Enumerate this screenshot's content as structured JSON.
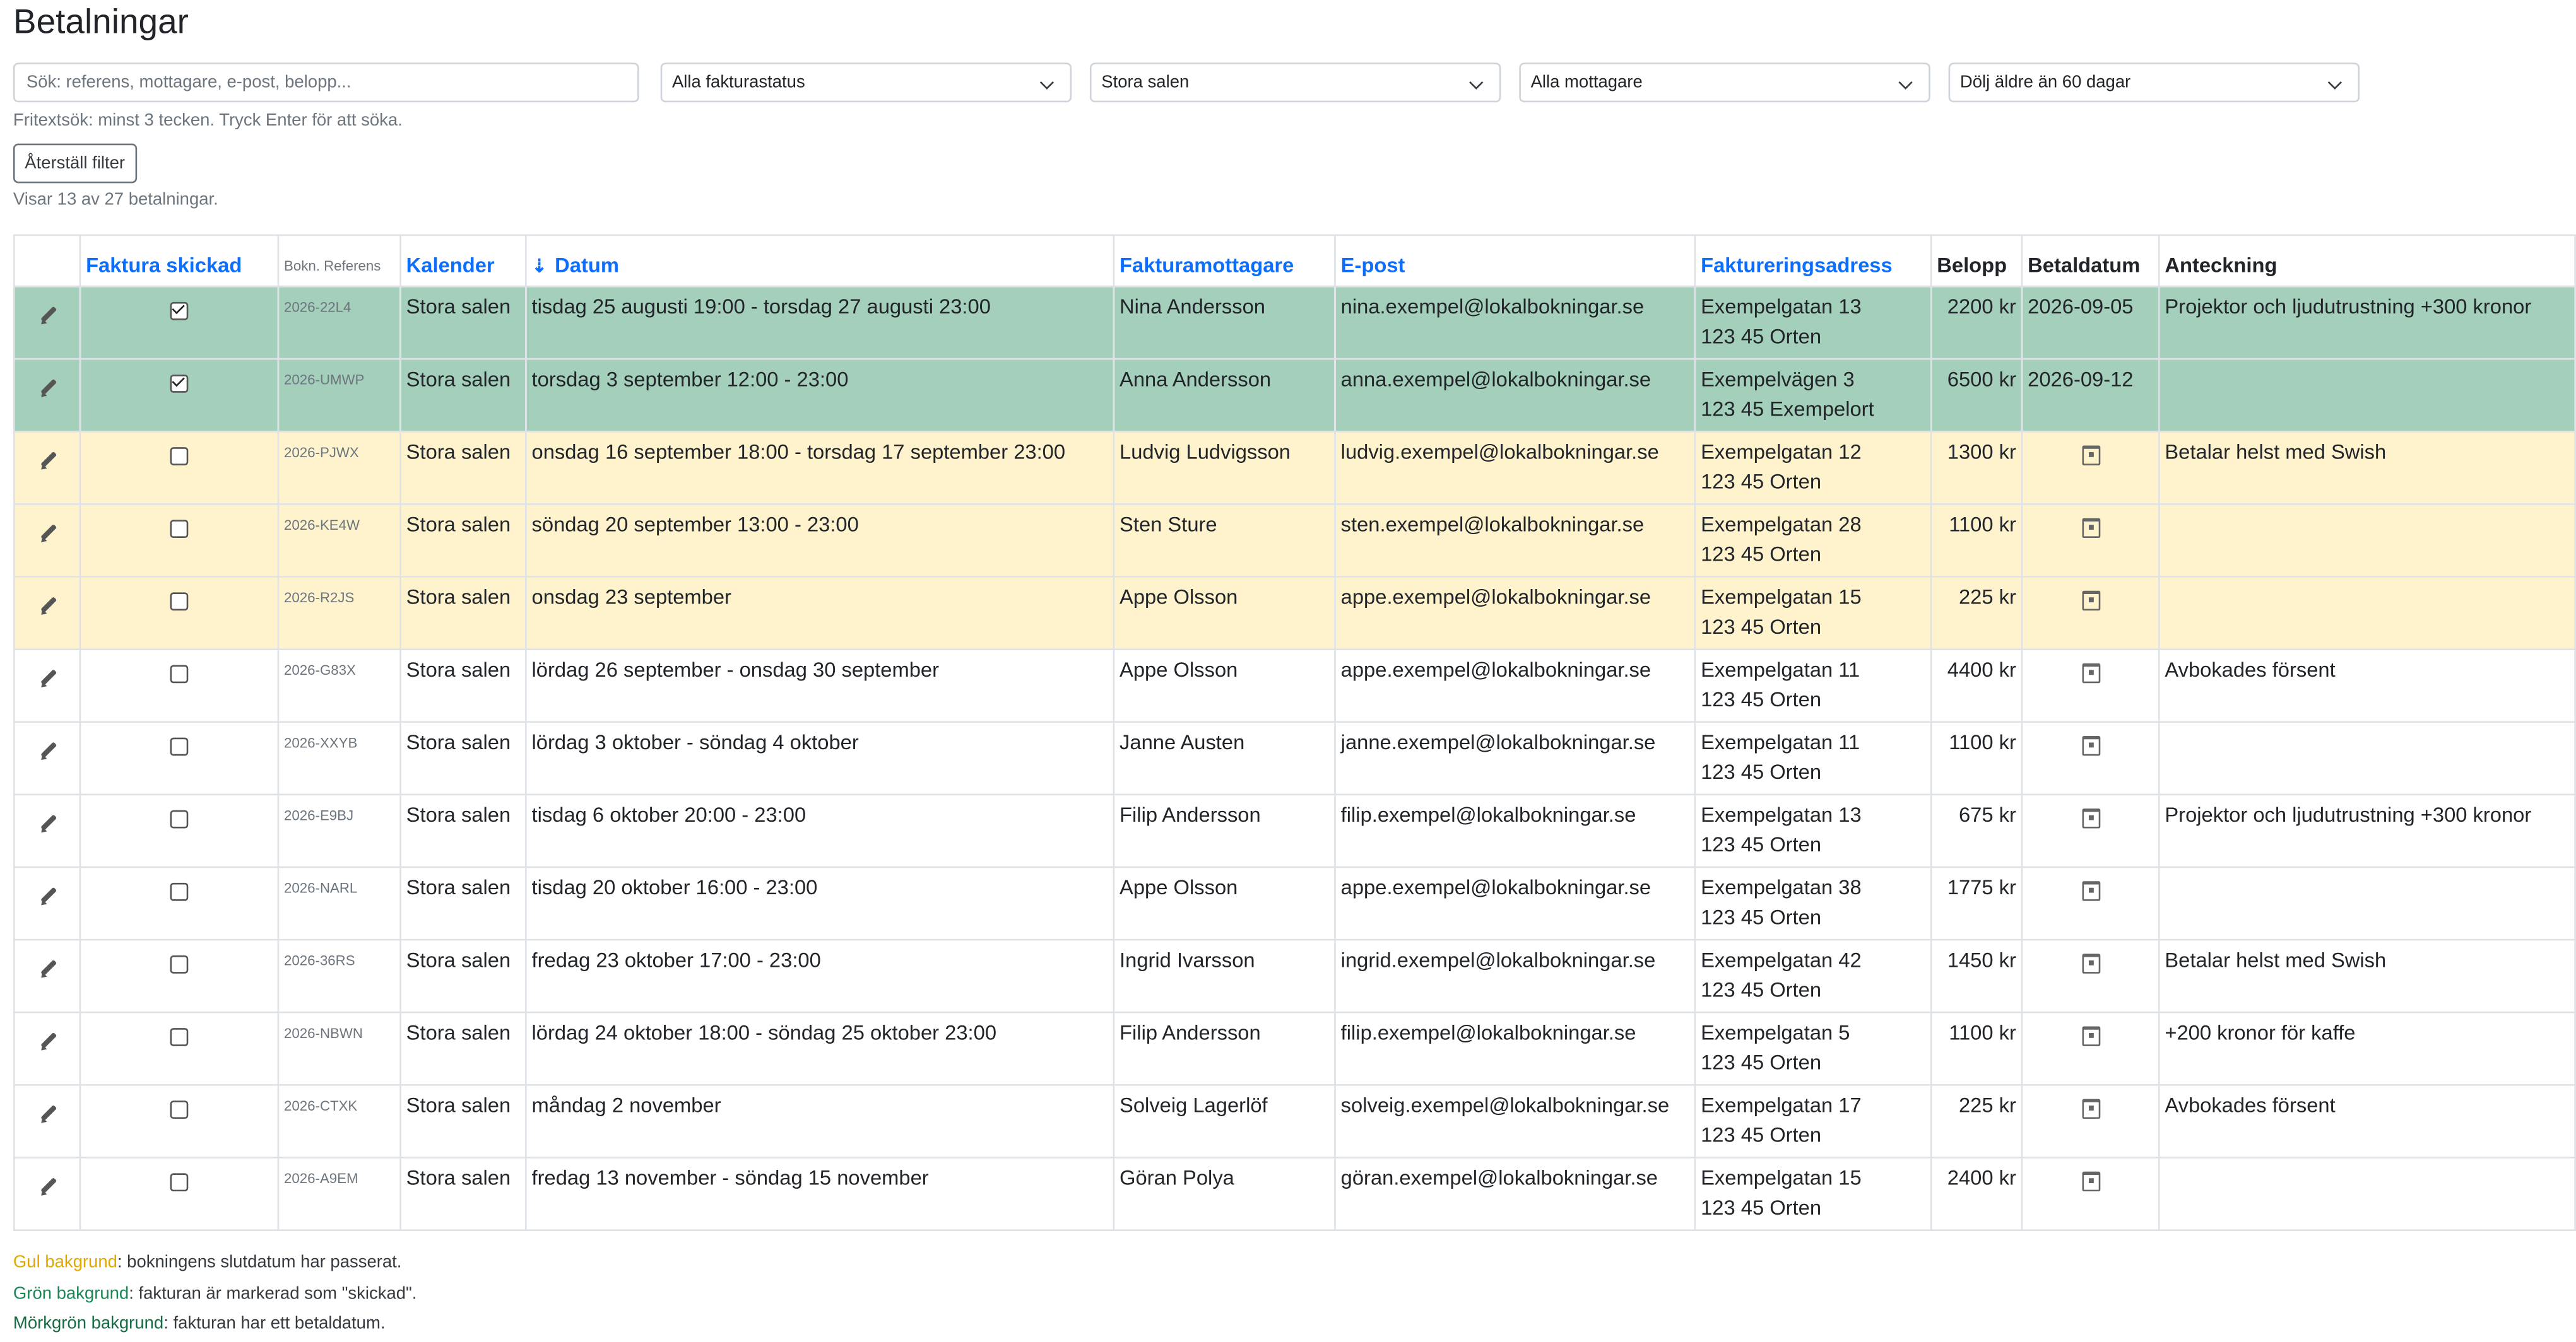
{
  "page_title": "Betalningar",
  "filters": {
    "search_placeholder": "Sök: referens, mottagare, e-post, belopp...",
    "status": "Alla fakturastatus",
    "calendar": "Stora salen",
    "recipient": "Alla mottagare",
    "age": "Dölj äldre än 60 dagar"
  },
  "search_hint": "Fritextsök: minst 3 tecken. Tryck Enter för att söka.",
  "reset_label": "Återställ filter",
  "count_text": "Visar 13 av 27 betalningar.",
  "headers": {
    "invoice_sent": "Faktura skickad",
    "ref": "Bokn. Referens",
    "calendar": "Kalender",
    "date": "Datum",
    "recipient": "Fakturamottagare",
    "email": "E-post",
    "address": "Faktureringsadress",
    "amount": "Belopp",
    "paid_date": "Betaldatum",
    "note": "Anteckning"
  },
  "rows": [
    {
      "status": "green",
      "sent": true,
      "ref": "2026-22L4",
      "cal": "Stora salen",
      "date": "tisdag 25 augusti 19:00 - torsdag 27 augusti 23:00",
      "name": "Nina Andersson",
      "email": "nina.exempel@lokalbokningar.se",
      "addr1": "Exempelgatan 13",
      "addr2": "123 45 Orten",
      "amount": "2200 kr",
      "paid": "2026-09-05",
      "note": "Projektor och ljudutrustning +300 kronor"
    },
    {
      "status": "green",
      "sent": true,
      "ref": "2026-UMWP",
      "cal": "Stora salen",
      "date": "torsdag 3 september 12:00 - 23:00",
      "name": "Anna Andersson",
      "email": "anna.exempel@lokalbokningar.se",
      "addr1": "Exempelvägen 3",
      "addr2": "123 45 Exempelort",
      "amount": "6500 kr",
      "paid": "2026-09-12",
      "note": ""
    },
    {
      "status": "yellow",
      "sent": false,
      "ref": "2026-PJWX",
      "cal": "Stora salen",
      "date": "onsdag 16 september 18:00 - torsdag 17 september 23:00",
      "name": "Ludvig Ludvigsson",
      "email": "ludvig.exempel@lokalbokningar.se",
      "addr1": "Exempelgatan 12",
      "addr2": "123 45 Orten",
      "amount": "1300 kr",
      "paid": "",
      "note": "Betalar helst med Swish"
    },
    {
      "status": "yellow",
      "sent": false,
      "ref": "2026-KE4W",
      "cal": "Stora salen",
      "date": "söndag 20 september 13:00 - 23:00",
      "name": "Sten Sture",
      "email": "sten.exempel@lokalbokningar.se",
      "addr1": "Exempelgatan 28",
      "addr2": "123 45 Orten",
      "amount": "1100 kr",
      "paid": "",
      "note": ""
    },
    {
      "status": "yellow",
      "sent": false,
      "ref": "2026-R2JS",
      "cal": "Stora salen",
      "date": "onsdag 23 september",
      "name": "Appe Olsson",
      "email": "appe.exempel@lokalbokningar.se",
      "addr1": "Exempelgatan 15",
      "addr2": "123 45 Orten",
      "amount": "225 kr",
      "paid": "",
      "note": ""
    },
    {
      "status": "",
      "sent": false,
      "ref": "2026-G83X",
      "cal": "Stora salen",
      "date": "lördag 26 september - onsdag 30 september",
      "name": "Appe Olsson",
      "email": "appe.exempel@lokalbokningar.se",
      "addr1": "Exempelgatan 11",
      "addr2": "123 45 Orten",
      "amount": "4400 kr",
      "paid": "",
      "note": "Avbokades försent"
    },
    {
      "status": "",
      "sent": false,
      "ref": "2026-XXYB",
      "cal": "Stora salen",
      "date": "lördag 3 oktober - söndag 4 oktober",
      "name": "Janne Austen",
      "email": "janne.exempel@lokalbokningar.se",
      "addr1": "Exempelgatan 11",
      "addr2": "123 45 Orten",
      "amount": "1100 kr",
      "paid": "",
      "note": ""
    },
    {
      "status": "",
      "sent": false,
      "ref": "2026-E9BJ",
      "cal": "Stora salen",
      "date": "tisdag 6 oktober 20:00 - 23:00",
      "name": "Filip Andersson",
      "email": "filip.exempel@lokalbokningar.se",
      "addr1": "Exempelgatan 13",
      "addr2": "123 45 Orten",
      "amount": "675 kr",
      "paid": "",
      "note": "Projektor och ljudutrustning +300 kronor"
    },
    {
      "status": "",
      "sent": false,
      "ref": "2026-NARL",
      "cal": "Stora salen",
      "date": "tisdag 20 oktober 16:00 - 23:00",
      "name": "Appe Olsson",
      "email": "appe.exempel@lokalbokningar.se",
      "addr1": "Exempelgatan 38",
      "addr2": "123 45 Orten",
      "amount": "1775 kr",
      "paid": "",
      "note": ""
    },
    {
      "status": "",
      "sent": false,
      "ref": "2026-36RS",
      "cal": "Stora salen",
      "date": "fredag 23 oktober 17:00 - 23:00",
      "name": "Ingrid Ivarsson",
      "email": "ingrid.exempel@lokalbokningar.se",
      "addr1": "Exempelgatan 42",
      "addr2": "123 45 Orten",
      "amount": "1450 kr",
      "paid": "",
      "note": "Betalar helst med Swish"
    },
    {
      "status": "",
      "sent": false,
      "ref": "2026-NBWN",
      "cal": "Stora salen",
      "date": "lördag 24 oktober 18:00 - söndag 25 oktober 23:00",
      "name": "Filip Andersson",
      "email": "filip.exempel@lokalbokningar.se",
      "addr1": "Exempelgatan 5",
      "addr2": "123 45 Orten",
      "amount": "1100 kr",
      "paid": "",
      "note": "+200 kronor för kaffe"
    },
    {
      "status": "",
      "sent": false,
      "ref": "2026-CTXK",
      "cal": "Stora salen",
      "date": "måndag 2 november",
      "name": "Solveig Lagerlöf",
      "email": "solveig.exempel@lokalbokningar.se",
      "addr1": "Exempelgatan 17",
      "addr2": "123 45 Orten",
      "amount": "225 kr",
      "paid": "",
      "note": "Avbokades försent"
    },
    {
      "status": "",
      "sent": false,
      "ref": "2026-A9EM",
      "cal": "Stora salen",
      "date": "fredag 13 november - söndag 15 november",
      "name": "Göran Polya",
      "email": "göran.exempel@lokalbokningar.se",
      "addr1": "Exempelgatan 15",
      "addr2": "123 45 Orten",
      "amount": "2400 kr",
      "paid": "",
      "note": ""
    }
  ],
  "legend": {
    "yellow_key": "Gul bakgrund",
    "yellow_text": ": bokningens slutdatum har passerat.",
    "green_key": "Grön bakgrund",
    "green_text": ": fakturan är markerad som \"skickad\".",
    "dgreen_key": "Mörkgrön bakgrund",
    "dgreen_text": ": fakturan har ett betaldatum."
  },
  "colors": {
    "green_row": "#a3cfbb",
    "yellow_row": "#fff3cd",
    "link": "#0d6efd"
  },
  "icons": {
    "edit": "pencil-icon",
    "sort": "sort-alpha-down-icon",
    "paid_date_empty": "calendar-icon",
    "select": "chevron-down-icon"
  }
}
